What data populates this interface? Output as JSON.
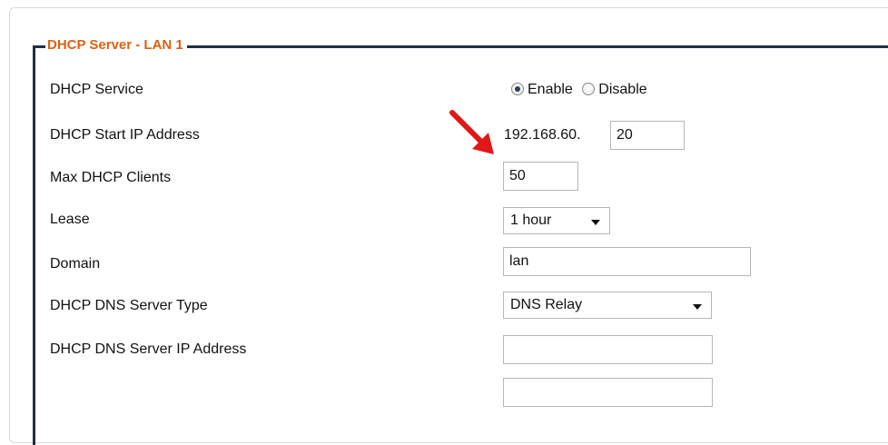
{
  "section": {
    "legend": "DHCP Server - LAN 1",
    "accent_color": "#e06010",
    "border_color": "#1f2f44"
  },
  "rows": {
    "service": {
      "label": "DHCP Service",
      "options": [
        {
          "label": "Enable",
          "checked": true
        },
        {
          "label": "Disable",
          "checked": false
        }
      ]
    },
    "start_ip": {
      "label": "DHCP Start IP Address",
      "prefix": "192.168.60.",
      "value": "20"
    },
    "max_clients": {
      "label": "Max DHCP Clients",
      "value": "50"
    },
    "lease": {
      "label": "Lease",
      "value": "1 hour"
    },
    "domain": {
      "label": "Domain",
      "value": "lan"
    },
    "dns_type": {
      "label": "DHCP DNS Server Type",
      "value": "DNS Relay"
    },
    "dns_ip": {
      "label": "DHCP DNS Server IP Address",
      "value1": "",
      "value2": ""
    }
  },
  "annotation": {
    "icon": "red-arrow-icon",
    "color": "#e01818"
  }
}
